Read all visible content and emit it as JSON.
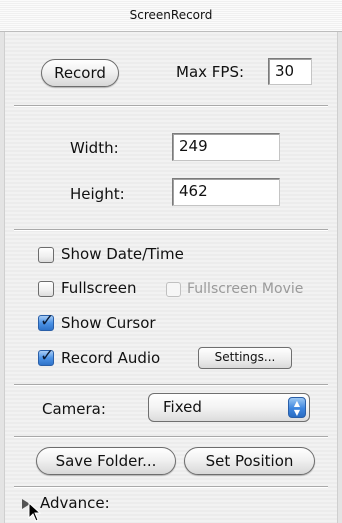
{
  "window": {
    "title": "ScreenRecord"
  },
  "top": {
    "record_label": "Record",
    "max_fps_label": "Max FPS:",
    "max_fps_value": "30"
  },
  "size": {
    "width_label": "Width:",
    "width_value": "249",
    "height_label": "Height:",
    "height_value": "462"
  },
  "options": {
    "show_datetime": {
      "label": "Show Date/Time",
      "checked": false
    },
    "fullscreen": {
      "label": "Fullscreen",
      "checked": false
    },
    "fullscreen_movie": {
      "label": "Fullscreen Movie",
      "checked": false,
      "enabled": false
    },
    "show_cursor": {
      "label": "Show Cursor",
      "checked": true
    },
    "record_audio": {
      "label": "Record Audio",
      "checked": true
    },
    "settings_label": "Settings..."
  },
  "camera": {
    "label": "Camera:",
    "value": "Fixed"
  },
  "bottom": {
    "save_folder_label": "Save Folder...",
    "set_position_label": "Set Position"
  },
  "advance": {
    "label": "Advance:"
  },
  "colors": {
    "accent": "#3e86df",
    "window_bg": "#efefef",
    "disabled_text": "#9a9a9a"
  }
}
